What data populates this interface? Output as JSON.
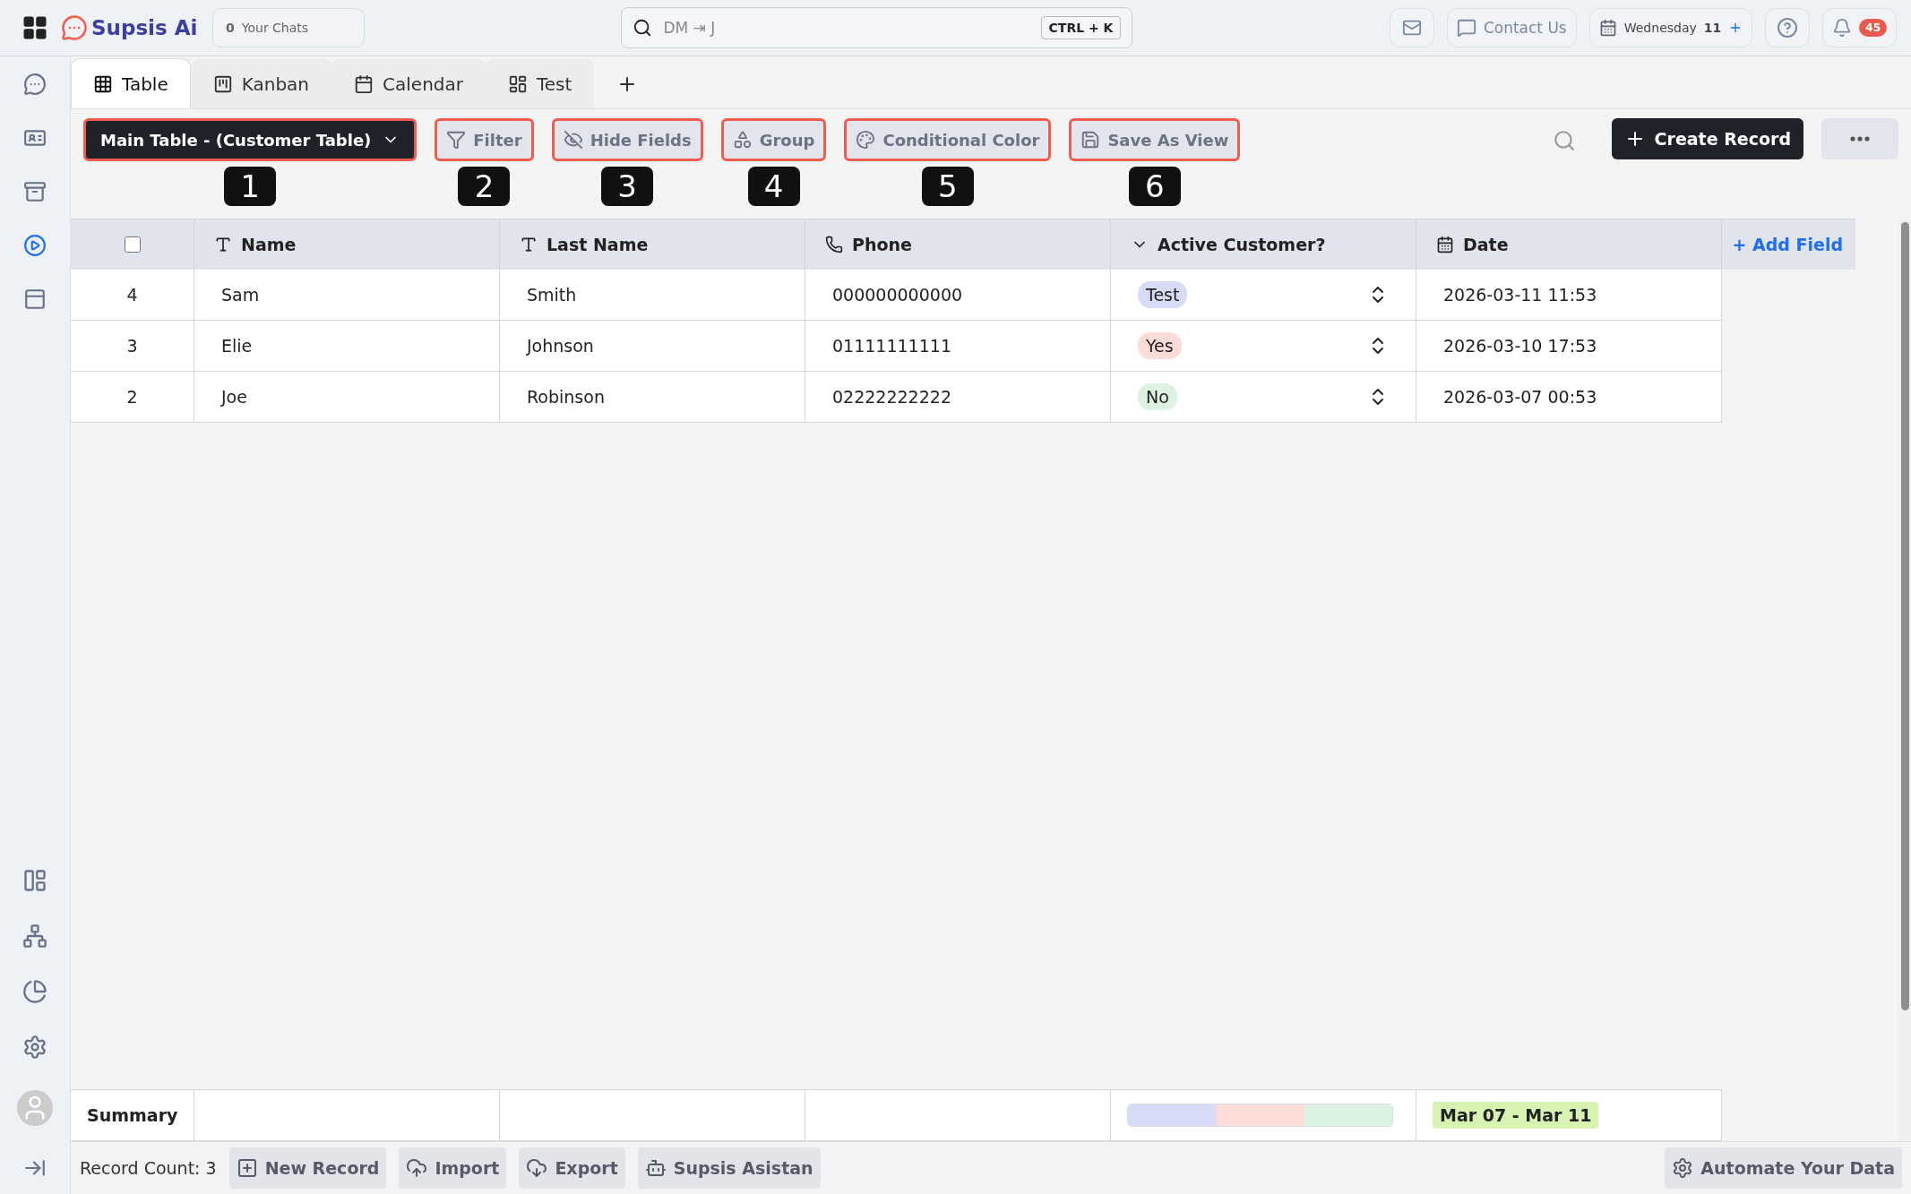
{
  "top_bar": {
    "logo": "Supsis Ai",
    "chats": {
      "count": "0",
      "label": "Your Chats"
    },
    "search": {
      "placeholder": "DM ⇥ J",
      "shortcut": "CTRL + K"
    },
    "contact": "Contact Us",
    "calendar": {
      "day": "Wednesday",
      "date": "11"
    },
    "notification_count": "45"
  },
  "sidebar": {
    "items": [
      {
        "selected": false
      },
      {
        "selected": false
      },
      {
        "selected": false
      },
      {
        "selected": true
      },
      {
        "selected": false
      }
    ]
  },
  "tabs": [
    {
      "label": "Table",
      "selected": true
    },
    {
      "label": "Kanban",
      "selected": false
    },
    {
      "label": "Calendar",
      "selected": false
    },
    {
      "label": "Test",
      "selected": false
    }
  ],
  "toolbar": {
    "view": "Main Table - (Customer Table)",
    "view_badge": "1",
    "buttons": [
      {
        "label": "Filter",
        "badge": "2"
      },
      {
        "label": "Hide Fields",
        "badge": "3"
      },
      {
        "label": "Group",
        "badge": "4"
      },
      {
        "label": "Conditional Color",
        "badge": "5"
      },
      {
        "label": "Save As View",
        "badge": "6"
      }
    ],
    "create": "Create Record"
  },
  "table": {
    "select_all": {
      "checked": false
    },
    "columns": [
      "Name",
      "Last Name",
      "Phone",
      "Active Customer?",
      "Date"
    ],
    "add_field": "+ Add Field",
    "rows": [
      {
        "index": "4",
        "name": "Sam",
        "last_name": "Smith",
        "phone": "000000000000",
        "active": {
          "label": "Test",
          "color": "#d8dbf6"
        },
        "date": "2026-03-11 11:53"
      },
      {
        "index": "3",
        "name": "Elie",
        "last_name": "Johnson",
        "phone": "01111111111",
        "active": {
          "label": "Yes",
          "color": "#fbdcd6"
        },
        "date": "2026-03-10 17:53"
      },
      {
        "index": "2",
        "name": "Joe",
        "last_name": "Robinson",
        "phone": "02222222222",
        "active": {
          "label": "No",
          "color": "#dcf2e3"
        },
        "date": "2026-03-07 00:53"
      }
    ],
    "summary": {
      "label": "Summary",
      "date_range": "Mar 07 - Mar 11"
    }
  },
  "footer": {
    "record_count": "Record Count: 3",
    "buttons": [
      "New Record",
      "Import",
      "Export",
      "Supsis Asistan"
    ],
    "automate": "Automate Your Data"
  }
}
